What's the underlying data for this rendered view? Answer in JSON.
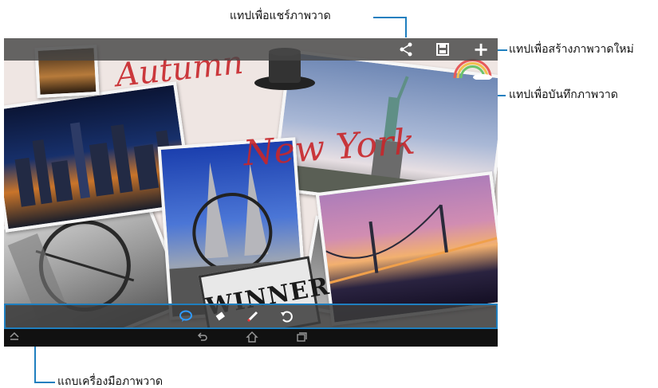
{
  "callouts": {
    "share": "แทปเพื่อแชร์ภาพวาด",
    "new": "แทปเพื่อสร้างภาพวาดใหม่",
    "save": "แทปเพื่อบันทึกภาพวาด",
    "toolbar": "แถบเครื่องมือภาพวาด"
  },
  "canvas": {
    "scribble_1": "Autumn",
    "scribble_2": "New York",
    "sign_text": "WINNER"
  },
  "topbar": {
    "icons": [
      "share-icon",
      "save-icon",
      "add-icon"
    ]
  },
  "toolbar": {
    "tools": [
      "speech-bubble-icon",
      "eraser-icon",
      "pen-icon",
      "undo-icon"
    ]
  },
  "navbar": {
    "icons": [
      "home-up-icon",
      "back-icon",
      "home-icon",
      "recent-apps-icon"
    ]
  },
  "colors": {
    "accent": "#1f7fbf",
    "ink": "#c8262a",
    "active_tool": "#2f9bff"
  }
}
